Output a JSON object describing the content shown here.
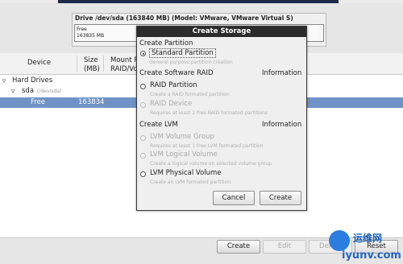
{
  "drive": {
    "title": "Drive /dev/sda (163840 MB) (Model: VMware, VMware Virtual S)",
    "map_label": "Free",
    "map_size": "163835 MB"
  },
  "table": {
    "columns": [
      "Device",
      "Size\n(MB)",
      "Mount P\nRAID/Vo"
    ],
    "rows": [
      {
        "device": "Hard Drives",
        "size": ""
      },
      {
        "device": "sda",
        "sub": "(/dev/sda)",
        "size": ""
      },
      {
        "device": "Free",
        "size": "163834"
      }
    ]
  },
  "bottom_buttons": {
    "create": "Create",
    "edit": "Edit",
    "delete": "Delete",
    "reset": "Reset"
  },
  "dialog": {
    "title": "Create Storage",
    "sections": {
      "partition": "Create Partition",
      "software_raid": "Create Software RAID",
      "raid_info": "Information",
      "lvm": "Create LVM",
      "lvm_info": "Information"
    },
    "options": {
      "standard_partition": {
        "label": "Standard Partition",
        "desc": "General purpose partition creation"
      },
      "raid_partition": {
        "label": "RAID Partition",
        "desc": "Create a RAID formated partition"
      },
      "raid_device": {
        "label": "RAID Device",
        "desc": "Requires at least 2 free RAID formated partitions"
      },
      "lvm_volume_group": {
        "label": "LVM Volume Group",
        "desc": "Requires at least 1 free LVM formated partition"
      },
      "lvm_logical_volume": {
        "label": "LVM Logical Volume",
        "desc": "Create a logical volume on selected volume group"
      },
      "lvm_physical_volume": {
        "label": "LVM Physical Volume",
        "desc": "Create an LVM formated partition"
      }
    },
    "selected": "standard_partition",
    "cancel": "Cancel",
    "create": "Create"
  },
  "watermark": {
    "cn": "运维网",
    "en": "iyunv.com"
  },
  "colors": {
    "selection": "#6f93c6",
    "dialog_title_bg": "#2b2b2b",
    "watermark_blue": "#2b7de0"
  }
}
